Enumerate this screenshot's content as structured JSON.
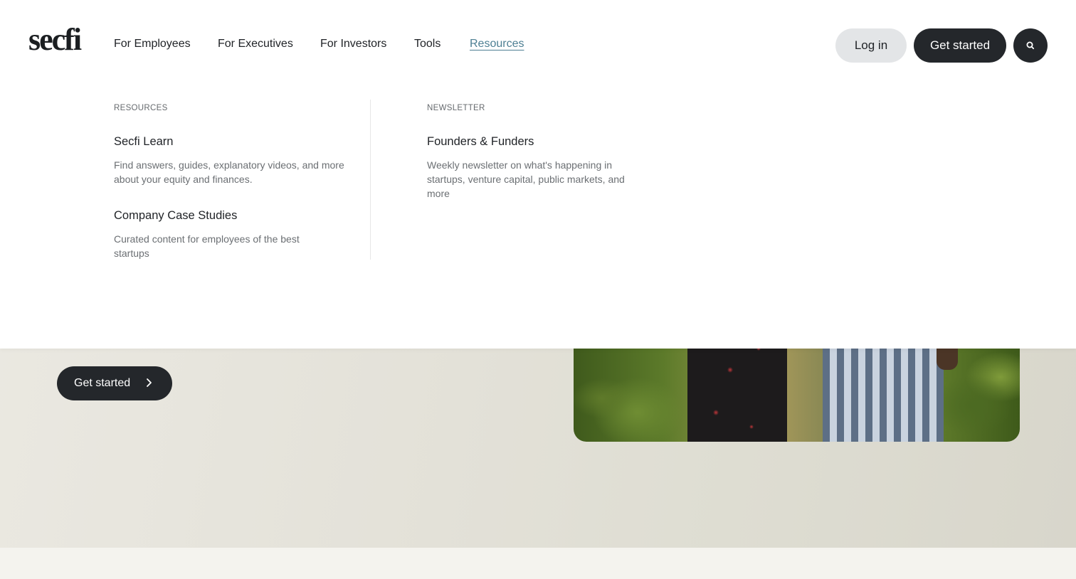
{
  "brand": {
    "logo_text": "secfi"
  },
  "nav": {
    "items": [
      {
        "label": "For Employees"
      },
      {
        "label": "For Executives"
      },
      {
        "label": "For Investors"
      },
      {
        "label": "Tools"
      },
      {
        "label": "Resources",
        "active": true
      }
    ]
  },
  "header_actions": {
    "login_label": "Log in",
    "get_started_label": "Get started",
    "search_icon": "search-icon"
  },
  "mega_menu": {
    "resources": {
      "heading": "RESOURCES",
      "links": [
        {
          "title": "Secfi Learn",
          "description": "Find answers, guides, explanatory videos, and more about your equity and finances."
        },
        {
          "title": "Company Case Studies",
          "description": "Curated content for employees of the best startups"
        }
      ]
    },
    "newsletter": {
      "heading": "NEWSLETTER",
      "links": [
        {
          "title": "Founders & Funders",
          "description": "Weekly newsletter on what's happening in startups, venture capital, public markets, and more"
        }
      ]
    }
  },
  "hero": {
    "cta_label": "Get started",
    "cta_icon": "chevron-right-icon"
  },
  "colors": {
    "accent_link": "#4d7f93",
    "dark_button": "#24272b",
    "light_button": "#e3e5e7"
  }
}
